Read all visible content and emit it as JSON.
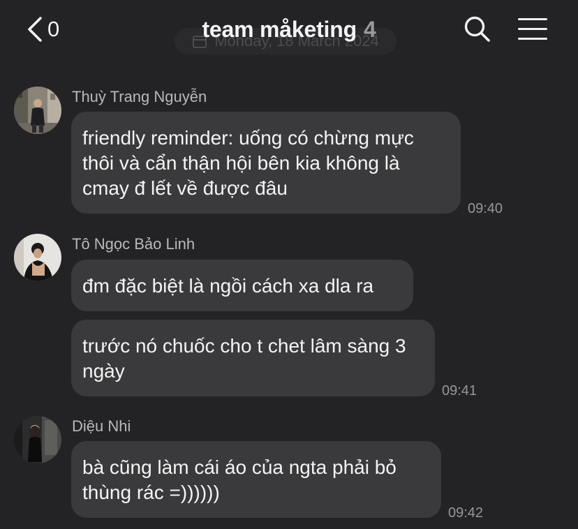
{
  "header": {
    "back_count": "0",
    "title": "team måketing",
    "member_count": "4",
    "date_ghost": "Monday, 18 March 2024"
  },
  "messages": [
    {
      "sender": "Thuỳ Trang Nguyễn",
      "bubbles": [
        "friendly reminder: uống có chừng mực thôi và cẩn thận hội bên kia không là cmay đ lết về được đâu"
      ],
      "time": "09:40"
    },
    {
      "sender": "Tô Ngọc Bảo Linh",
      "bubbles": [
        "đm đặc biệt là ngồi cách xa dla ra",
        "trước nó chuốc cho t chet lâm sàng 3 ngày"
      ],
      "time": "09:41"
    },
    {
      "sender": "Diệu Nhi",
      "bubbles": [
        "bà cũng làm cái áo của ngta phải bỏ thùng rác =))))))"
      ],
      "time": "09:42"
    }
  ],
  "colors": {
    "background": "#232325",
    "bubble": "#3a3a3c",
    "sender": "#b9b9bc",
    "time": "#97979a",
    "text": "#f4f4f4"
  },
  "icons": [
    "chevron-left-icon",
    "search-icon",
    "hamburger-menu-icon",
    "calendar-icon"
  ]
}
